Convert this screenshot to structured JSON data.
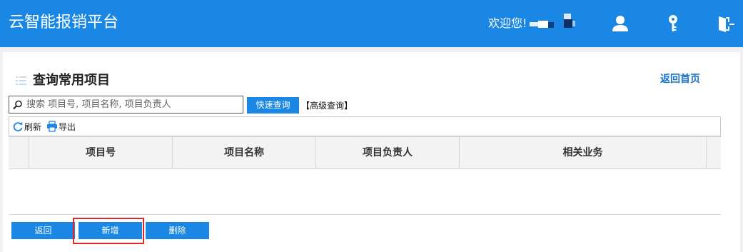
{
  "header": {
    "app_title": "云智能报销平台",
    "welcome": "欢迎您!",
    "icons": [
      "user-icon",
      "key-icon",
      "logout-icon"
    ],
    "color": "#1a87e5"
  },
  "page": {
    "title": "查询常用项目",
    "home_link": "返回首页"
  },
  "search": {
    "placeholder": "搜索 项目号, 项目名称, 项目负责人",
    "value": "",
    "quick_button": "快速查询",
    "advanced_link": "【高级查询】"
  },
  "toolbar": {
    "refresh": "刷新",
    "export": "导出"
  },
  "table": {
    "columns": [
      "项目号",
      "项目名称",
      "项目负责人",
      "相关业务"
    ],
    "rows": []
  },
  "actions": {
    "back": "返回",
    "add": "新增",
    "delete": "删除",
    "highlight_color": "#e0262b"
  }
}
